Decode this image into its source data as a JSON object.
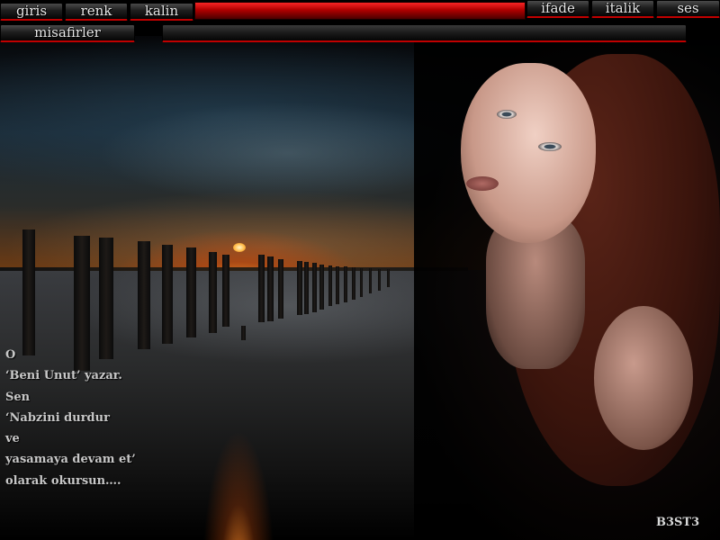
{
  "toolbar_left": [
    {
      "label": "giris",
      "name": "giris-button"
    },
    {
      "label": "renk",
      "name": "renk-button"
    },
    {
      "label": "kalin",
      "name": "kalin-button"
    }
  ],
  "toolbar_right": [
    {
      "label": "ifade",
      "name": "ifade-button"
    },
    {
      "label": "italik",
      "name": "italik-button"
    },
    {
      "label": "ses",
      "name": "ses-button"
    }
  ],
  "guests_label": "misafirler",
  "message_input": {
    "value": "",
    "placeholder": ""
  },
  "poem": [
    "O",
    "‘Beni Unut’  yazar.",
    "Sen",
    "‘Nabzini durdur",
    " ve",
    " yasamaya devam et’",
    " olarak okursun…."
  ],
  "signature": "B3ST3",
  "colors": {
    "accent": "#c00000",
    "button_bg": "#1e1e1e",
    "text": "#e8e8e8"
  }
}
